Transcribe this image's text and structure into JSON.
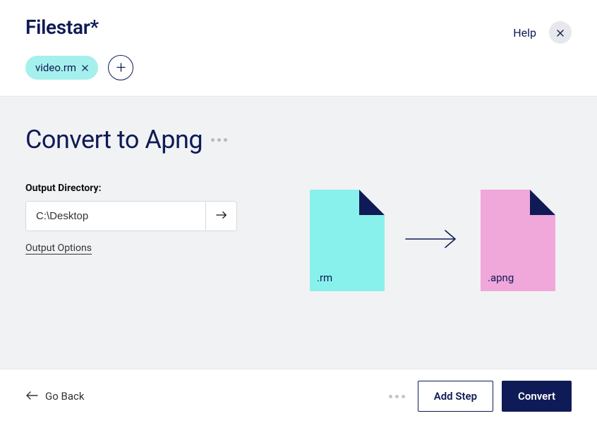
{
  "header": {
    "brand": "Filestar*",
    "help_label": "Help"
  },
  "chips": {
    "items": [
      {
        "label": "video.rm"
      }
    ]
  },
  "main": {
    "title": "Convert to Apng",
    "output_directory_label": "Output Directory:",
    "output_directory_value": "C:\\Desktop",
    "output_options_label": "Output Options",
    "source_ext": ".rm",
    "target_ext": ".apng"
  },
  "footer": {
    "go_back_label": "Go Back",
    "add_step_label": "Add Step",
    "convert_label": "Convert"
  }
}
